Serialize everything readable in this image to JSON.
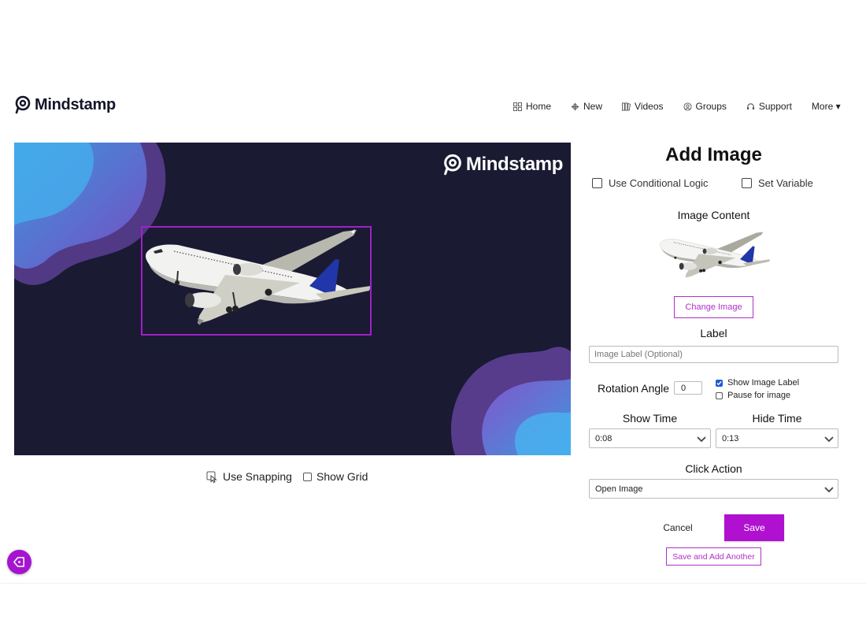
{
  "brand": {
    "name": "Mindstamp"
  },
  "nav": [
    {
      "label": "Home",
      "icon": "grid-icon"
    },
    {
      "label": "New",
      "icon": "plus-icon"
    },
    {
      "label": "Videos",
      "icon": "videos-icon"
    },
    {
      "label": "Groups",
      "icon": "groups-icon"
    },
    {
      "label": "Support",
      "icon": "headset-icon"
    },
    {
      "label": "More ▾",
      "icon": ""
    }
  ],
  "canvas": {
    "brand_watermark": "Mindstamp",
    "image": "airplane"
  },
  "canvas_options": {
    "use_snapping": "Use Snapping",
    "show_grid": "Show Grid"
  },
  "panel": {
    "title": "Add Image",
    "use_conditional_logic": "Use Conditional Logic",
    "set_variable": "Set Variable",
    "image_content_label": "Image Content",
    "change_image": "Change Image",
    "label_heading": "Label",
    "label_placeholder": "Image Label (Optional)",
    "rotation_label": "Rotation Angle",
    "rotation_value": "0",
    "show_image_label": "Show Image Label",
    "show_image_label_checked": true,
    "pause_for_image": "Pause for image",
    "pause_for_image_checked": false,
    "show_time_label": "Show Time",
    "show_time_value": "0:08",
    "hide_time_label": "Hide Time",
    "hide_time_value": "0:13",
    "click_action_label": "Click Action",
    "click_action_value": "Open Image",
    "cancel": "Cancel",
    "save": "Save",
    "save_and_add": "Save and Add Another"
  },
  "colors": {
    "accent": "#b010d0",
    "canvas_bg": "#1a1a33",
    "checkbox_checked": "#1a5fd1"
  }
}
